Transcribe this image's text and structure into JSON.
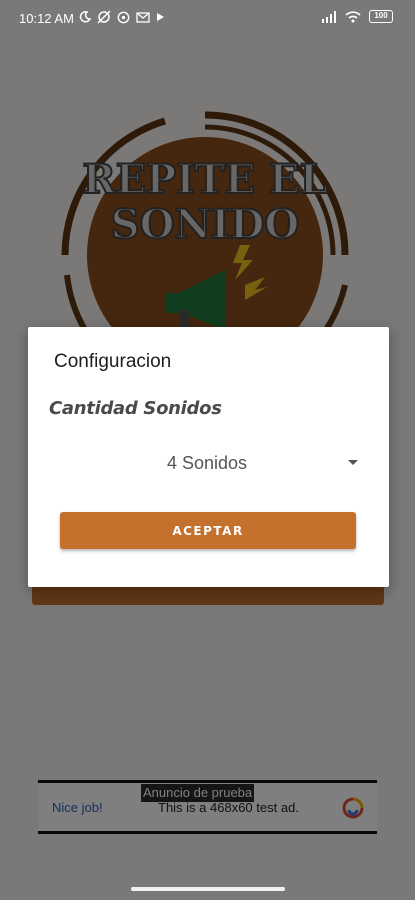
{
  "status_bar": {
    "time": "10:12 AM",
    "battery": "100",
    "left_icons": [
      "moon-icon",
      "no-alarm-icon",
      "whatsapp-icon",
      "mail-icon",
      "play-icon"
    ],
    "right_icons": [
      "signal-icon",
      "wifi-icon",
      "battery-icon"
    ]
  },
  "app": {
    "logo_line1": "REPITE EL",
    "logo_line2": "SONIDO",
    "logo_icon": "megaphone-icon"
  },
  "dialog": {
    "title": "Configuracion",
    "label": "Cantidad Sonidos",
    "selected_option": "4 Sonidos",
    "accept_label": "ACEPTAR"
  },
  "ad": {
    "tag": "Anuncio de prueba",
    "nice": "Nice job!",
    "text": "This is a 468x60 test ad."
  },
  "colors": {
    "accent": "#c5712e",
    "logo_brown": "#8a4c1c",
    "logo_ring": "#5a3412"
  }
}
